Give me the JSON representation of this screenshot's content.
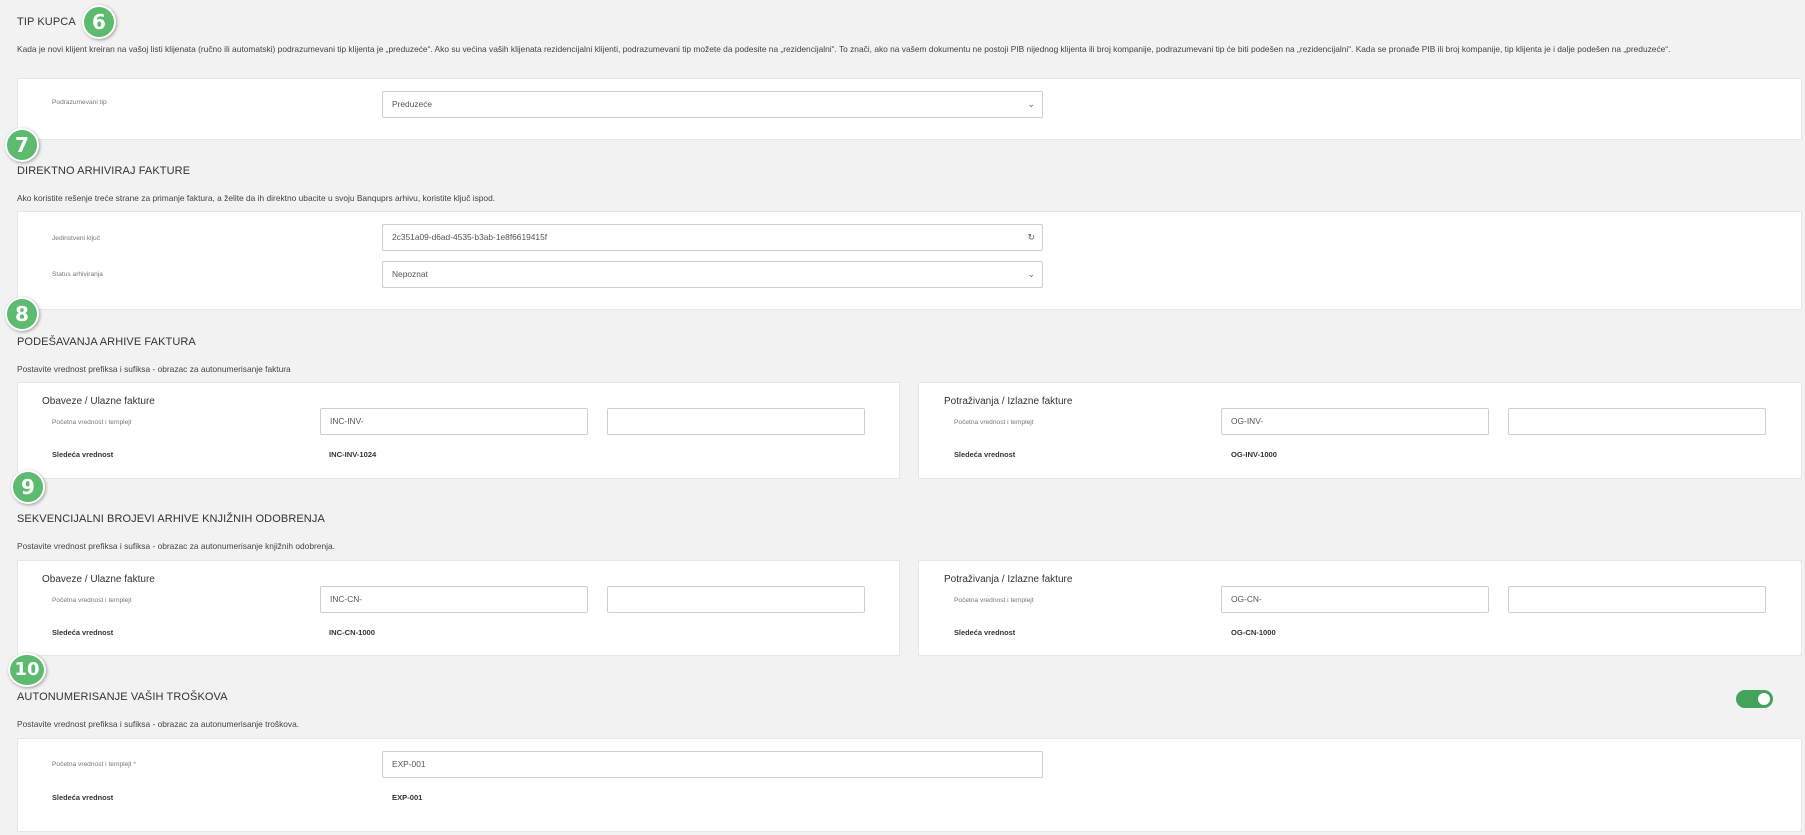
{
  "badges": [
    "6",
    "7",
    "8",
    "9",
    "10"
  ],
  "tip_kupca": {
    "title": "TIP KUPCA",
    "description": "Kada je novi klijent kreiran na vašoj listi klijenata (ručno ili automatski) podrazumevani tip klijenta je „preduzeće“. Ako su većina vaših klijenata rezidencijalni klijenti, podrazumevani tip možete da podesite na „rezidencijalni“. To znači, ako na vašem dokumentu ne postoji PIB nijednog klijenta ili broj kompanije, podrazumevani tip će biti podešen na „rezidencijalni“. Kada se pronađe PIB ili broj kompanije, tip klijenta je i dalje podešen na „preduzeće“.",
    "default_type_label": "Podrazumevani tip",
    "default_type_value": "Preduzeće"
  },
  "direct_archive": {
    "title": "DIREKTNO ARHIVIRAJ FAKTURE",
    "description": "Ako koristite rešenje treće strane za primanje faktura, a želite da ih direktno ubacite u svoju Banquprs arhivu, koristite ključ ispod.",
    "unique_key_label": "Jedinstveni ključ",
    "unique_key_value": "2c351a09-d6ad-4535-b3ab-1e8f6619415f",
    "status_label": "Status arhiviranja",
    "status_value": "Nepoznat"
  },
  "invoice_archive": {
    "title": "PODEŠAVANJA ARHIVE FAKTURA",
    "description": "Postavite vrednost prefiksa i sufiksa - obrazac za autonumerisanje faktura",
    "left": {
      "heading": "Obaveze / Ulazne fakture",
      "start_label": "Početna vrednost i templejt",
      "prefix_value": "INC-INV-",
      "suffix_value": "",
      "next_label": "Sledeća vrednost",
      "next_value": "INC-INV-1024"
    },
    "right": {
      "heading": "Potraživanja / Izlazne fakture",
      "start_label": "Početna vrednost i templejt",
      "prefix_value": "OG-INV-",
      "suffix_value": "",
      "next_label": "Sledeća vrednost",
      "next_value": "OG-INV-1000"
    }
  },
  "credit_archive": {
    "title": "SEKVENCIJALNI BROJEVI ARHIVE KNJIŽNIH ODOBRENJA",
    "description": "Postavite vrednost prefiksa i sufiksa - obrazac za autonumerisanje knjižnih odobrenja.",
    "left": {
      "heading": "Obaveze / Ulazne fakture",
      "start_label": "Početna vrednost i templejt",
      "prefix_value": "INC-CN-",
      "suffix_value": "",
      "next_label": "Sledeća vrednost",
      "next_value": "INC-CN-1000"
    },
    "right": {
      "heading": "Potraživanja / Izlazne fakture",
      "start_label": "Početna vrednost i templejt",
      "prefix_value": "OG-CN-",
      "suffix_value": "",
      "next_label": "Sledeća vrednost",
      "next_value": "OG-CN-1000"
    }
  },
  "expenses": {
    "title": "AUTONUMERISANJE VAŠIH TROŠKOVA",
    "description": "Postavite vrednost prefiksa i sufiksa - obrazac za autonumerisanje troškova.",
    "start_label": "Početna vrednost i templejt *",
    "start_value": "EXP-001",
    "next_label": "Sledeća vrednost",
    "next_value": "EXP-001",
    "toggle_on": true
  },
  "icons": {
    "chevron": "chevron-down-icon",
    "refresh": "refresh-icon"
  },
  "colors": {
    "badge": "#5cbb6f",
    "toggle": "#43a35b",
    "background": "#f2f2f2"
  }
}
